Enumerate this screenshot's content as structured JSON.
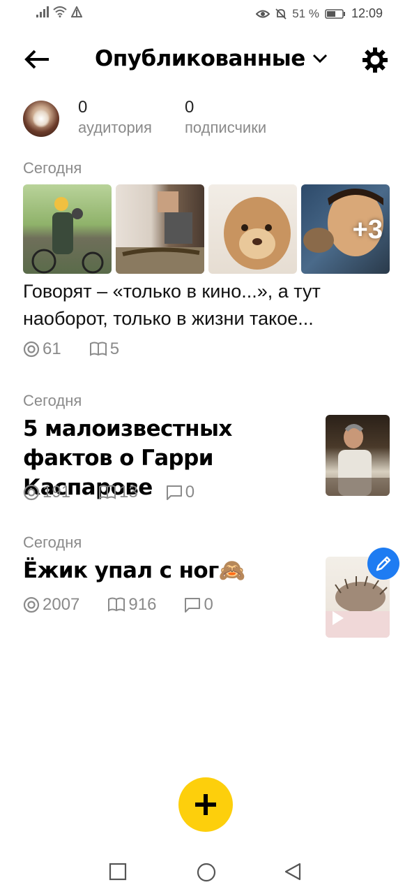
{
  "status_bar": {
    "battery_percent": "51 %",
    "time": "12:09",
    "icons": [
      "signal-icon",
      "wifi-icon",
      "data-icon",
      "eye-icon",
      "mute-icon",
      "battery-icon"
    ]
  },
  "header": {
    "title": "Опубликованные",
    "icons": {
      "back": "arrow-left-icon",
      "dropdown": "chevron-down-icon",
      "settings": "gear-icon"
    }
  },
  "profile": {
    "audience_value": "0",
    "audience_label": "аудитория",
    "subscribers_value": "0",
    "subscribers_label": "подписчики"
  },
  "posts": [
    {
      "date": "Сегодня",
      "text": "Говорят – «только в кино...», а тут наоборот, только в жизни такое...",
      "more_count": "+3",
      "views": "61",
      "reads": "5"
    },
    {
      "date": "Сегодня",
      "title": "5 малоизвестных фактов о Гарри Каспарове",
      "views": "191",
      "reads": "13",
      "comments": "0"
    },
    {
      "date": "Сегодня",
      "title": "Ёжик упал с ног🙈",
      "views": "2007",
      "reads": "916",
      "comments": "0"
    }
  ],
  "colors": {
    "accent": "#fdcf0c",
    "edit_badge": "#1e7cf2",
    "secondary_text": "#8a8a8a"
  }
}
